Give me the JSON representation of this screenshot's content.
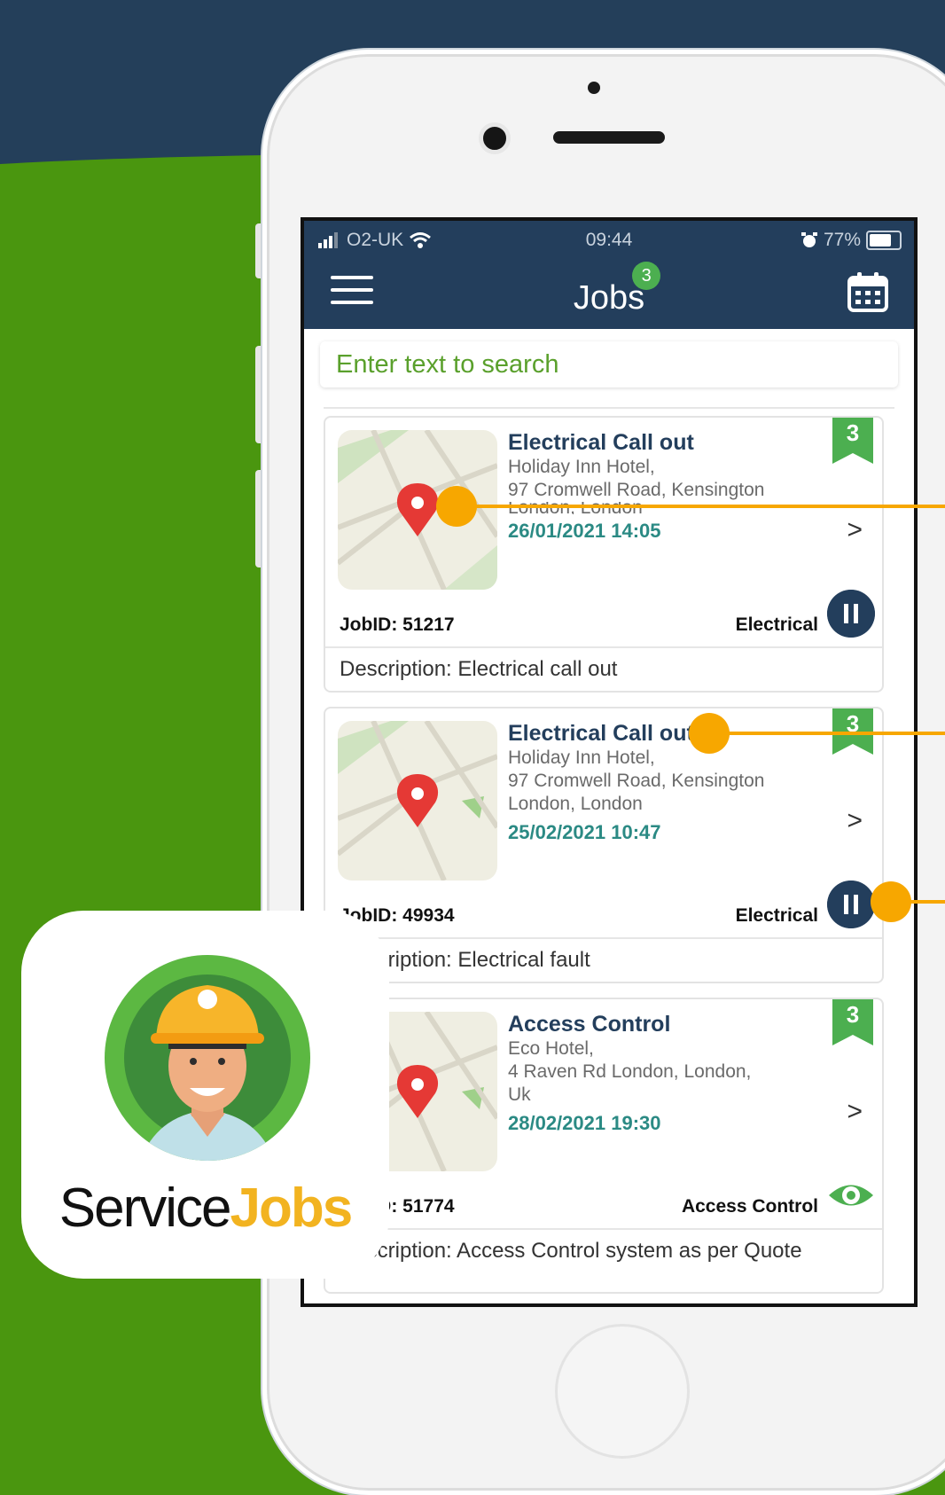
{
  "status_bar": {
    "carrier": "O2-UK",
    "time": "09:44",
    "battery": "77%"
  },
  "header": {
    "title": "Jobs",
    "badge_count": "3"
  },
  "search": {
    "placeholder": "Enter text to search"
  },
  "jobs": [
    {
      "title": "Electrical Call out",
      "address_lines": [
        "Holiday Inn Hotel,",
        "97 Cromwell Road, Kensington",
        "London,  London"
      ],
      "datetime": "26/01/2021 14:05",
      "priority": "3",
      "job_id": "JobID: 51217",
      "category": "Electrical",
      "action": "pause-icon",
      "description": "Description: Electrical call out"
    },
    {
      "title": "Electrical Call out",
      "address_lines": [
        "Holiday Inn Hotel,",
        "97 Cromwell Road, Kensington",
        "London,  London"
      ],
      "datetime": "25/02/2021 10:47",
      "priority": "3",
      "job_id": "JobID: 49934",
      "category": "Electrical",
      "action": "pause-icon",
      "description": "Description: Electrical fault"
    },
    {
      "title": "Access Control",
      "address_lines": [
        "Eco Hotel,",
        "4 Raven Rd London,  London,",
        " Uk"
      ],
      "datetime": "28/02/2021 19:30",
      "priority": "3",
      "job_id": "JobID: 51774",
      "category": "Access Control",
      "action": "eye-icon",
      "description": "Description: Access Control system as per Quote"
    }
  ],
  "chevron": ">",
  "brand": {
    "part1": "Service",
    "part2": "Jobs"
  },
  "colors": {
    "navy": "#233e5c",
    "green": "#4a960f",
    "accent": "#f7a700",
    "ribbon": "#4caf50"
  }
}
